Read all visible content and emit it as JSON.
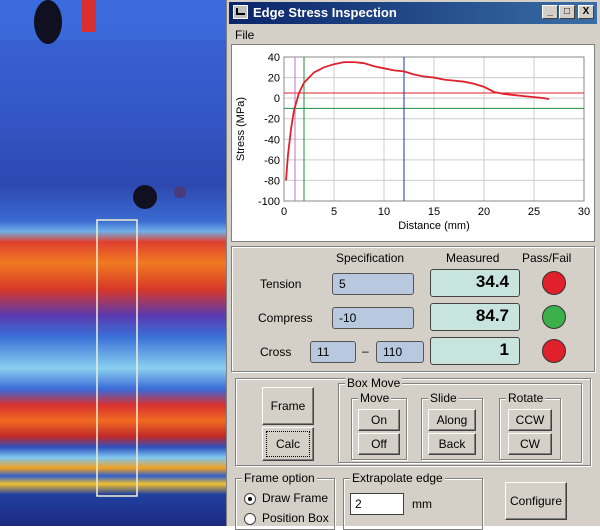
{
  "window": {
    "title": "Edge Stress Inspection",
    "minimize": "_",
    "maximize": "□",
    "close": "X"
  },
  "menu": {
    "file": "File"
  },
  "chart_data": {
    "type": "line",
    "xlabel": "Distance (mm)",
    "ylabel": "Stress (MPa)",
    "xlim": [
      0,
      30
    ],
    "ylim": [
      -100,
      40
    ],
    "xticks": [
      0,
      5,
      10,
      15,
      20,
      25,
      30
    ],
    "yticks": [
      40,
      20,
      0,
      -20,
      -40,
      -60,
      -80,
      -100
    ],
    "grid": true,
    "series": [
      {
        "color": "#e0202a",
        "x": [
          0.2,
          0.4,
          0.7,
          1.0,
          1.5,
          2.0,
          3.0,
          4.0,
          5.0,
          6.0,
          7.0,
          8.0,
          9.0,
          10.0,
          11.0,
          12.0,
          13.0,
          14.0,
          15.0,
          16.0,
          17.0,
          18.0,
          19.0,
          20.0,
          21.0,
          22.0,
          23.0,
          24.0,
          25.0,
          26.0,
          26.5
        ],
        "y": [
          -80,
          -55,
          -30,
          -12,
          5,
          15,
          25,
          30,
          33,
          35,
          35,
          34,
          31,
          29,
          27,
          26,
          23,
          21,
          20,
          18,
          17,
          16,
          14,
          11,
          6,
          4,
          3,
          2,
          1,
          0,
          -1
        ]
      }
    ],
    "reference_lines": [
      {
        "orientation": "horizontal",
        "value": 5,
        "color": "#e0202a"
      },
      {
        "orientation": "horizontal",
        "value": -10,
        "color": "#1e8e3e"
      },
      {
        "orientation": "vertical",
        "value": 1.1,
        "color": "#c070c0"
      },
      {
        "orientation": "vertical",
        "value": 2.0,
        "color": "#1e8e3e"
      },
      {
        "orientation": "vertical",
        "value": 12.0,
        "color": "#2030a0"
      }
    ]
  },
  "table": {
    "headers": {
      "spec": "Specification",
      "measured": "Measured",
      "pass": "Pass/Fail"
    },
    "rows": {
      "tension": {
        "label": "Tension",
        "spec": "5",
        "measured": "34.4",
        "status": "fail",
        "color": "#e0202a"
      },
      "compress": {
        "label": "Compress",
        "spec": "-10",
        "measured": "84.7",
        "status": "pass",
        "color": "#3cb04a"
      },
      "cross": {
        "label": "Cross",
        "spec_min": "11",
        "sep": "–",
        "spec_max": "110",
        "measured": "1",
        "status": "fail",
        "color": "#e0202a"
      }
    }
  },
  "controls": {
    "frame": "Frame",
    "calc": "Calc",
    "box_move": {
      "title": "Box Move",
      "move": {
        "title": "Move",
        "on": "On",
        "off": "Off"
      },
      "slide": {
        "title": "Slide",
        "along": "Along",
        "back": "Back"
      },
      "rotate": {
        "title": "Rotate",
        "ccw": "CCW",
        "cw": "CW"
      }
    },
    "frame_option": {
      "title": "Frame option",
      "draw_frame": "Draw Frame",
      "position_box": "Position Box",
      "selected": "Draw Frame"
    },
    "extrapolate": {
      "title": "Extrapolate edge",
      "value": "2",
      "unit": "mm"
    },
    "configure": "Configure"
  }
}
